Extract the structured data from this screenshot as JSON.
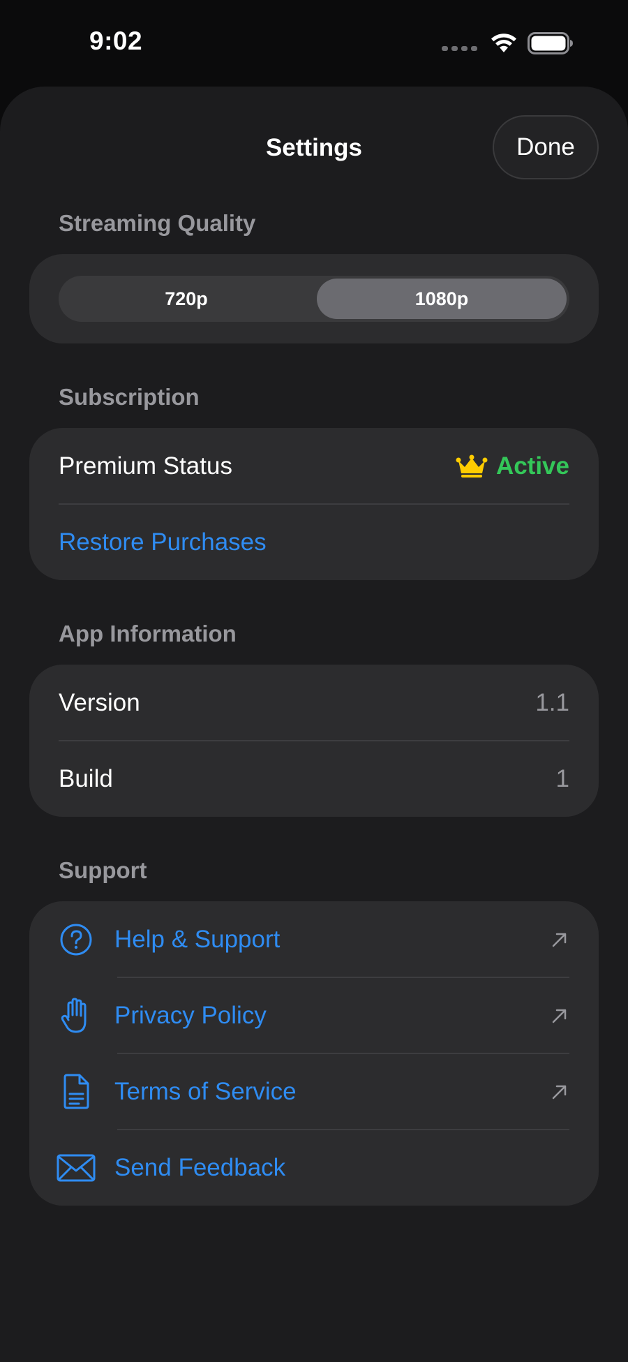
{
  "status_bar": {
    "time": "9:02"
  },
  "nav": {
    "title": "Settings",
    "done_label": "Done"
  },
  "streaming": {
    "header": "Streaming Quality",
    "options": [
      "720p",
      "1080p"
    ],
    "selected": "1080p"
  },
  "subscription": {
    "header": "Subscription",
    "premium_label": "Premium Status",
    "premium_value": "Active",
    "restore_label": "Restore Purchases"
  },
  "app_info": {
    "header": "App Information",
    "rows": [
      {
        "label": "Version",
        "value": "1.1"
      },
      {
        "label": "Build",
        "value": "1"
      }
    ]
  },
  "support": {
    "header": "Support",
    "items": [
      {
        "label": "Help & Support",
        "icon": "question-circle-icon",
        "external": true
      },
      {
        "label": "Privacy Policy",
        "icon": "hand-raised-icon",
        "external": true
      },
      {
        "label": "Terms of Service",
        "icon": "document-icon",
        "external": true
      },
      {
        "label": "Send Feedback",
        "icon": "envelope-icon",
        "external": false
      }
    ]
  },
  "colors": {
    "accent_blue": "#2f8cf2",
    "active_green": "#34c759",
    "crown_yellow": "#ffcc00",
    "card_bg": "#2c2c2e",
    "sheet_bg": "#1c1c1e"
  }
}
